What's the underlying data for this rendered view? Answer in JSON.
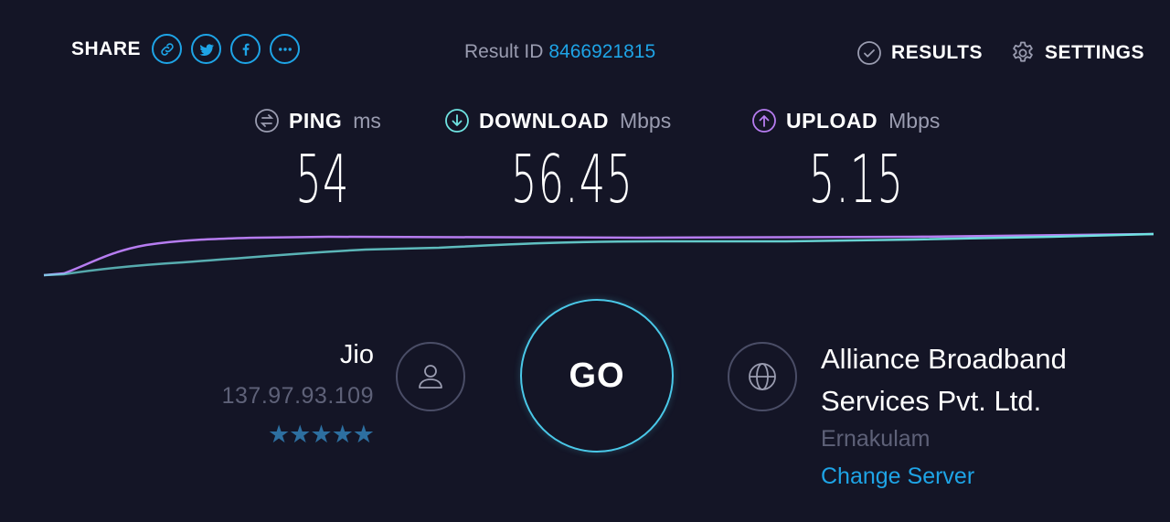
{
  "header": {
    "share_label": "SHARE",
    "share_buttons": [
      "link-icon",
      "twitter-icon",
      "facebook-icon",
      "more-icon"
    ],
    "result_id_label": "Result ID",
    "result_id_value": "8466921815",
    "results_label": "RESULTS",
    "settings_label": "SETTINGS"
  },
  "metrics": {
    "ping": {
      "label": "PING",
      "unit": "ms",
      "value": "54",
      "icon": "ping-icon"
    },
    "download": {
      "label": "DOWNLOAD",
      "unit": "Mbps",
      "value": "56.45",
      "icon": "download-arrow-icon",
      "color": "#6fe3e1"
    },
    "upload": {
      "label": "UPLOAD",
      "unit": "Mbps",
      "value": "5.15",
      "icon": "upload-arrow-icon",
      "color": "#b67cf0"
    }
  },
  "isp": {
    "name": "Jio",
    "ip": "137.97.93.109",
    "stars": "★★★★★",
    "rating": 5
  },
  "go": {
    "label": "GO",
    "ring_color": "#4ac8e8"
  },
  "server": {
    "name": "Alliance Broadband Services Pvt. Ltd.",
    "location": "Ernakulam",
    "change_label": "Change Server"
  },
  "colors": {
    "background": "#141526",
    "accent": "#1ea4e6",
    "muted": "#9a9cb0"
  }
}
